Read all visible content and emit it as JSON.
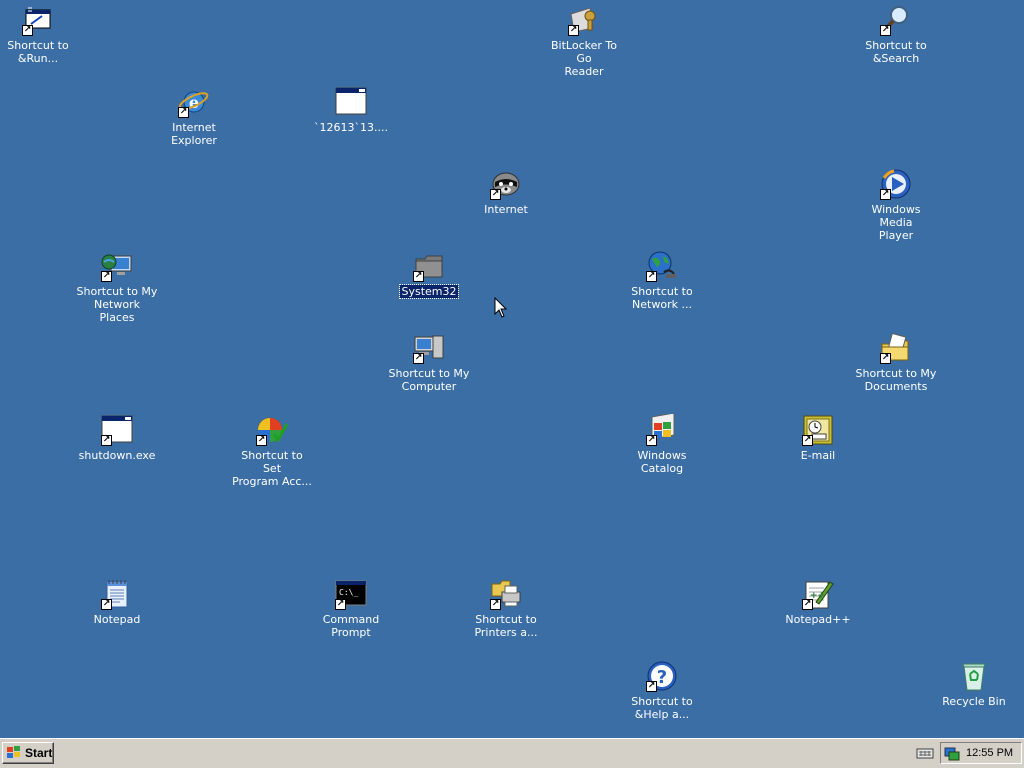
{
  "desktop": {
    "background_color": "#3a6ea5",
    "icons": {
      "run": {
        "label": "Shortcut to\n&Run...",
        "icon": "run-icon"
      },
      "bitlocker": {
        "label": "BitLocker To Go\nReader",
        "icon": "bitlocker-icon"
      },
      "search": {
        "label": "Shortcut to\n&Search",
        "icon": "search-icon"
      },
      "ie": {
        "label": "Internet\nExplorer",
        "icon": "internet-explorer-icon"
      },
      "num": {
        "label": "`12613`13....",
        "icon": "window-icon"
      },
      "internet": {
        "label": "Internet",
        "icon": "raccoon-icon"
      },
      "wmp": {
        "label": "Windows Media\nPlayer",
        "icon": "media-player-icon"
      },
      "netplaces": {
        "label": "Shortcut to My\nNetwork Places",
        "icon": "network-places-icon"
      },
      "system32": {
        "label": "System32",
        "icon": "folder-icon"
      },
      "network": {
        "label": "Shortcut to\nNetwork ...",
        "icon": "network-globe-icon"
      },
      "mycomputer": {
        "label": "Shortcut to My\nComputer",
        "icon": "my-computer-icon"
      },
      "mydocs": {
        "label": "Shortcut to My\nDocuments",
        "icon": "my-documents-icon"
      },
      "shutdown": {
        "label": "shutdown.exe",
        "icon": "window-icon"
      },
      "setprog": {
        "label": "Shortcut to Set\nProgram Acc...",
        "icon": "program-access-icon"
      },
      "catalog": {
        "label": "Windows\nCatalog",
        "icon": "windows-catalog-icon"
      },
      "email": {
        "label": "E-mail",
        "icon": "email-icon"
      },
      "notepad": {
        "label": "Notepad",
        "icon": "notepad-icon"
      },
      "cmd": {
        "label": "Command\nPrompt",
        "icon": "command-prompt-icon"
      },
      "printers": {
        "label": "Shortcut to\nPrinters a...",
        "icon": "printer-icon"
      },
      "notepadpp": {
        "label": "Notepad++",
        "icon": "notepadpp-icon"
      },
      "help": {
        "label": "Shortcut to\n&Help a...",
        "icon": "help-icon"
      },
      "recycle": {
        "label": "Recycle Bin",
        "icon": "recycle-bin-icon"
      }
    }
  },
  "taskbar": {
    "start_label": "Start",
    "clock": "12:55 PM"
  }
}
